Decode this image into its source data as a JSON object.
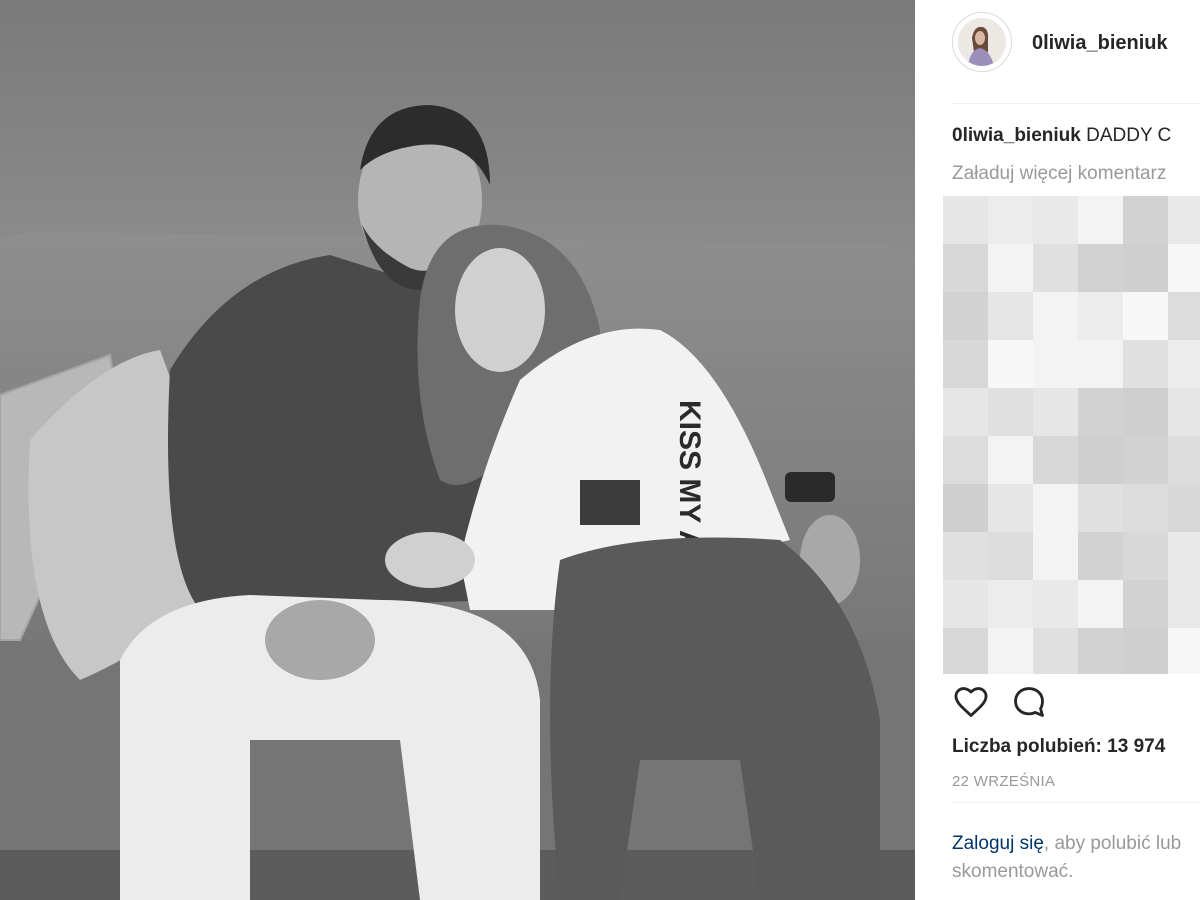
{
  "photo": {
    "alt_icon": "photo-image",
    "shirt_text": "KISS MY ASS"
  },
  "post": {
    "username": "0liwia_bieniuk",
    "caption_username": "0liwia_bieniuk",
    "caption_text": "DADDY C",
    "load_more": "Załaduj więcej komentarz",
    "likes": "Liczba polubień: 13 974",
    "date": "22 WRZEŚNIA",
    "login_link": "Zaloguj się",
    "login_text": ", aby polubić lub skomentować."
  },
  "icons": {
    "like": "heart-icon",
    "comment": "comment-icon"
  },
  "colors": {
    "link": "#003569",
    "muted": "#999999",
    "text": "#262626"
  }
}
